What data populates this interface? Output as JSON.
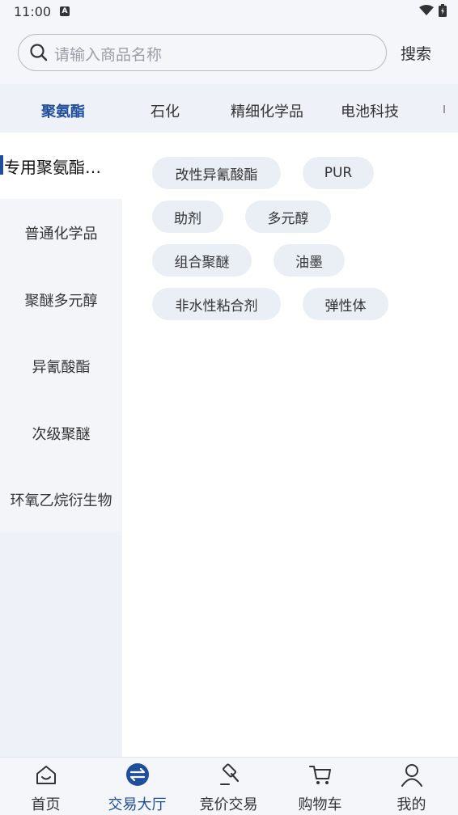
{
  "status": {
    "time": "11:00",
    "notification_glyph": "A"
  },
  "search": {
    "placeholder": "请输入商品名称",
    "button_label": "搜索"
  },
  "category_tabs": [
    {
      "label": "聚氨酯",
      "active": true
    },
    {
      "label": "石化",
      "active": false
    },
    {
      "label": "精细化学品",
      "active": false
    },
    {
      "label": "电池科技",
      "active": false
    }
  ],
  "sidebar": [
    {
      "label": "专用聚氨酯…",
      "active": true
    },
    {
      "label": "普通化学品",
      "active": false
    },
    {
      "label": "聚醚多元醇",
      "active": false
    },
    {
      "label": "异氰酸酯",
      "active": false
    },
    {
      "label": "次级聚醚",
      "active": false
    },
    {
      "label": "环氧乙烷衍生物",
      "active": false
    }
  ],
  "chips": [
    "改性异氰酸酯",
    "PUR",
    "助剂",
    "多元醇",
    "组合聚醚",
    "油墨",
    "非水性粘合剂",
    "弹性体"
  ],
  "bottom_nav": [
    {
      "label": "首页",
      "icon": "home-icon",
      "active": false
    },
    {
      "label": "交易大厅",
      "icon": "exchange-icon",
      "active": true
    },
    {
      "label": "竞价交易",
      "icon": "auction-hammer-icon",
      "active": false
    },
    {
      "label": "购物车",
      "icon": "cart-icon",
      "active": false
    },
    {
      "label": "我的",
      "icon": "profile-icon",
      "active": false
    }
  ],
  "colors": {
    "accent": "#1f4e9c",
    "chip_bg": "#eaeef5",
    "header_bg": "#f4f6fa"
  }
}
